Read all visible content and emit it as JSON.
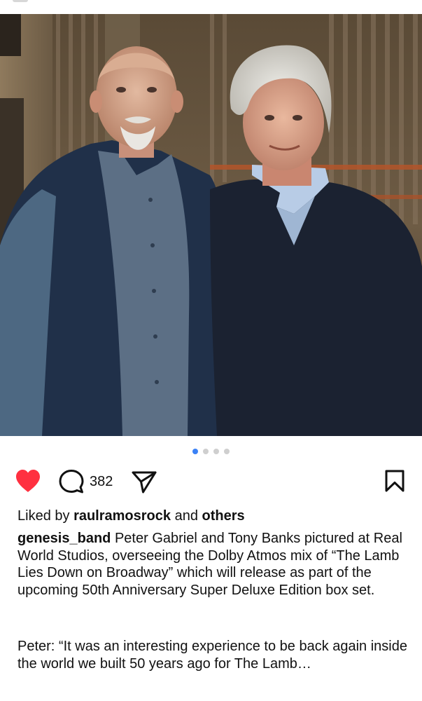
{
  "post": {
    "author": "genesis_band",
    "comment_count": "382",
    "liked": true,
    "carousel": {
      "total": 4,
      "active_index": 0
    },
    "likes": {
      "prefix": "Liked by",
      "user": "raulramosrock",
      "conjunction": "and",
      "others": "others"
    },
    "caption": "Peter Gabriel and Tony Banks pictured at Real World Studios, overseeing the Dolby Atmos mix of “The Lamb Lies Down on Broadway” which will release as part of the upcoming 50th Anniversary Super Deluxe Edition box set.",
    "quote": "Peter: “It was an interesting experience to be back again inside the world we built 50 years ago for The Lamb…"
  },
  "icons": {
    "like": "heart-icon",
    "comment": "speech-bubble-icon",
    "share": "paper-plane-icon",
    "save": "bookmark-icon"
  },
  "colors": {
    "like_red": "#ff3040",
    "dot_active": "#3b82f6",
    "dot_inactive": "#cfcfcf",
    "text": "#111111"
  }
}
